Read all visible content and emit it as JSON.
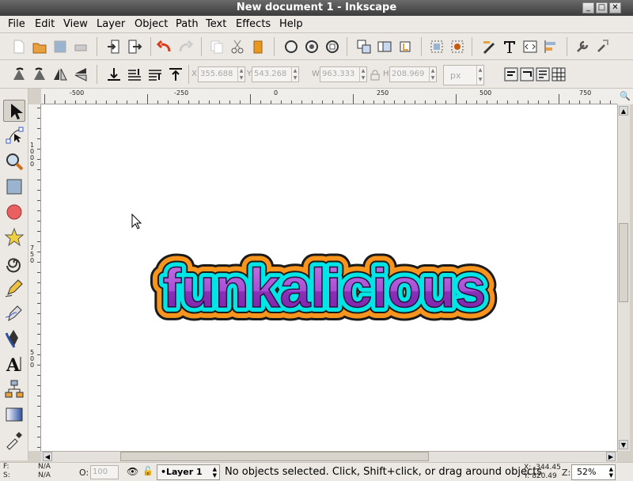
{
  "window": {
    "title": "New document 1 - Inkscape"
  },
  "menu": [
    "File",
    "Edit",
    "View",
    "Layer",
    "Object",
    "Path",
    "Text",
    "Effects",
    "Help"
  ],
  "toolbar2": {
    "x_label": "X",
    "x_value": "355.688",
    "y_label": "Y",
    "y_value": "543.268",
    "w_label": "W",
    "w_value": "963.333",
    "h_label": "H",
    "h_value": "208.969",
    "unit": "px"
  },
  "ruler": {
    "h_labels": [
      "-500",
      "-250",
      "0",
      "250",
      "500",
      "750"
    ],
    "v_labels": [
      "1000",
      "750",
      "500"
    ]
  },
  "canvas": {
    "artwork_text": "funkalicious"
  },
  "colors": {
    "outline_orange": "#f7941d",
    "inner_cyan": "#00e5e5",
    "text_purple": "#9b30c8",
    "stroke_dark": "#1a1a1a"
  },
  "status": {
    "fill_label": "F:",
    "fill_value": "N/A",
    "stroke_label": "S:",
    "stroke_value": "N/A",
    "opacity_label": "O:",
    "opacity_value": "100",
    "layer": "Layer 1",
    "message": "No objects selected. Click, Shift+click, or drag around objects",
    "x_coord": "X: -344.45",
    "y_coord": "Y:  820.49",
    "zoom_label": "Z:",
    "zoom": "52%"
  }
}
